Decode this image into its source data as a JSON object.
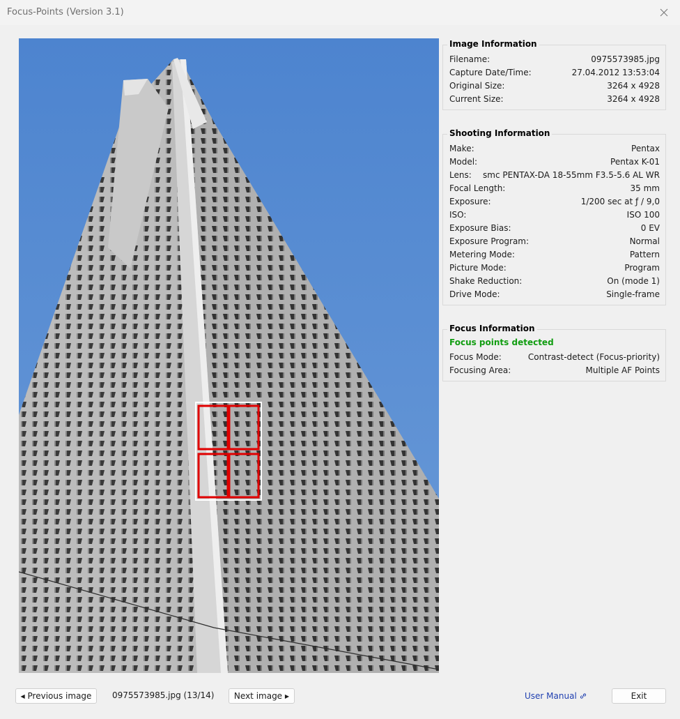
{
  "window": {
    "title": "Focus-Points (Version 3.1)"
  },
  "image_info": {
    "heading": "Image Information",
    "rows": [
      {
        "label": "Filename:",
        "value": "0975573985.jpg"
      },
      {
        "label": "Capture Date/Time:",
        "value": "27.04.2012 13:53:04"
      },
      {
        "label": "Original Size:",
        "value": "3264 x 4928"
      },
      {
        "label": "Current Size:",
        "value": "3264 x 4928"
      }
    ]
  },
  "shooting_info": {
    "heading": "Shooting Information",
    "rows": [
      {
        "label": "Make:",
        "value": "Pentax"
      },
      {
        "label": "Model:",
        "value": "Pentax K-01"
      },
      {
        "label": "Lens:",
        "value": "smc PENTAX-DA 18-55mm F3.5-5.6 AL WR"
      },
      {
        "label": "Focal Length:",
        "value": "35 mm"
      },
      {
        "label": "Exposure:",
        "value": "1/200 sec at ƒ / 9,0"
      },
      {
        "label": "ISO:",
        "value": "ISO 100"
      },
      {
        "label": "Exposure Bias:",
        "value": "0 EV"
      },
      {
        "label": "Exposure Program:",
        "value": "Normal"
      },
      {
        "label": "Metering Mode:",
        "value": "Pattern"
      },
      {
        "label": "Picture Mode:",
        "value": "Program"
      },
      {
        "label": "Shake Reduction:",
        "value": "On (mode 1)"
      },
      {
        "label": "Drive Mode:",
        "value": "Single-frame"
      }
    ]
  },
  "focus_info": {
    "heading": "Focus Information",
    "status": "Focus points detected",
    "rows": [
      {
        "label": "Focus Mode:",
        "value": "Contrast-detect (Focus-priority)"
      },
      {
        "label": "Focusing Area:",
        "value": "Multiple AF Points"
      }
    ]
  },
  "footer": {
    "prev_label": "Previous image",
    "nav_info": "0975573985.jpg (13/14)",
    "next_label": "Next image",
    "manual_label": "User Manual",
    "exit_label": "Exit"
  },
  "colors": {
    "sky": "#5b8fd0",
    "focus_box": "#e00000",
    "status_green": "#119d11",
    "link": "#1f3fb0"
  },
  "icons": {
    "close": "close-icon",
    "prev": "triangle-left-icon",
    "next": "triangle-right-icon",
    "manual": "link-icon"
  }
}
